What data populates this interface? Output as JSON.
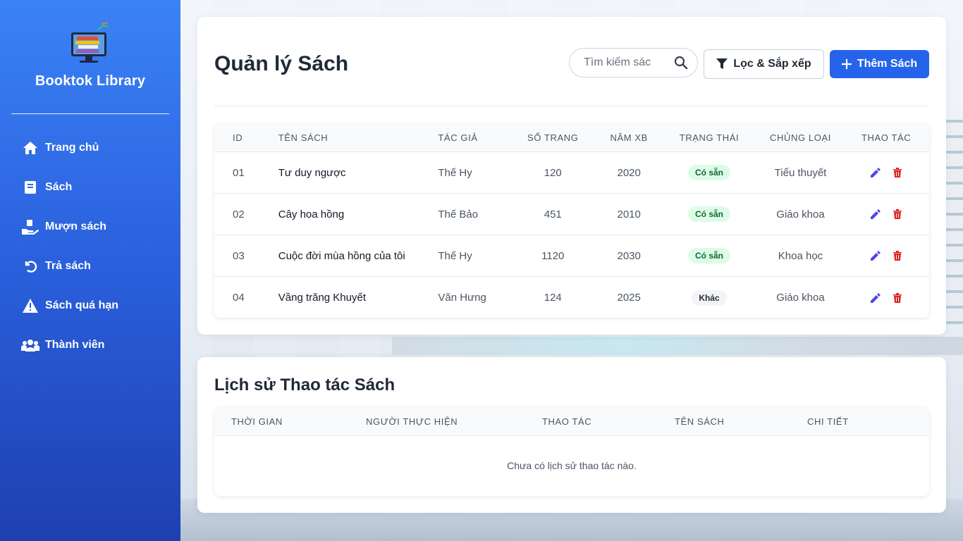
{
  "sidebar": {
    "brand": "Booktok Library",
    "items": [
      {
        "label": "Trang chủ",
        "icon": "home-icon"
      },
      {
        "label": "Sách",
        "icon": "book-icon"
      },
      {
        "label": "Mượn sách",
        "icon": "hand-book-icon"
      },
      {
        "label": "Trả sách",
        "icon": "undo-icon"
      },
      {
        "label": "Sách quá hạn",
        "icon": "warning-icon"
      },
      {
        "label": "Thành viên",
        "icon": "users-icon"
      }
    ]
  },
  "books": {
    "title": "Quản lý Sách",
    "search_placeholder": "Tìm kiếm sác",
    "filter_label": "Lọc & Sắp xếp",
    "add_label": "Thêm Sách",
    "columns": [
      "ID",
      "TÊN SÁCH",
      "TÁC GIẢ",
      "SỐ TRANG",
      "NĂM XB",
      "TRẠNG THÁI",
      "CHỦNG LOẠI",
      "THAO TÁC"
    ],
    "rows": [
      {
        "id": "01",
        "name": "Tư duy ngược",
        "author": "Thế Hy",
        "pages": "120",
        "year": "2020",
        "status": "Có sẵn",
        "type": "Tiểu thuyết"
      },
      {
        "id": "02",
        "name": "Cây hoa hồng",
        "author": "Thế Bảo",
        "pages": "451",
        "year": "2010",
        "status": "Có sẵn",
        "type": "Giáo khoa"
      },
      {
        "id": "03",
        "name": "Cuộc đời mùa hồng của tôi",
        "author": "Thế Hy",
        "pages": "1120",
        "year": "2030",
        "status": "Có sẵn",
        "type": "Khoa học"
      },
      {
        "id": "04",
        "name": "Vầng trăng Khuyết",
        "author": "Văn Hưng",
        "pages": "124",
        "year": "2025",
        "status": "Khác",
        "type": "Giáo khoa"
      }
    ]
  },
  "history": {
    "title": "Lịch sử Thao tác Sách",
    "columns": [
      "THỜI GIAN",
      "NGƯỜI THỰC HIỆN",
      "THAO TÁC",
      "TÊN SÁCH",
      "CHI TIẾT"
    ],
    "empty_text": "Chưa có lịch sử thao tác nào."
  },
  "colors": {
    "accent": "#2563eb",
    "sidebar_top": "#3b82f6",
    "sidebar_bottom": "#1e40af",
    "edit": "#4f46e5",
    "delete": "#dc2626",
    "status_available_bg": "#dcfce7",
    "status_other_bg": "#f3f4f6"
  }
}
